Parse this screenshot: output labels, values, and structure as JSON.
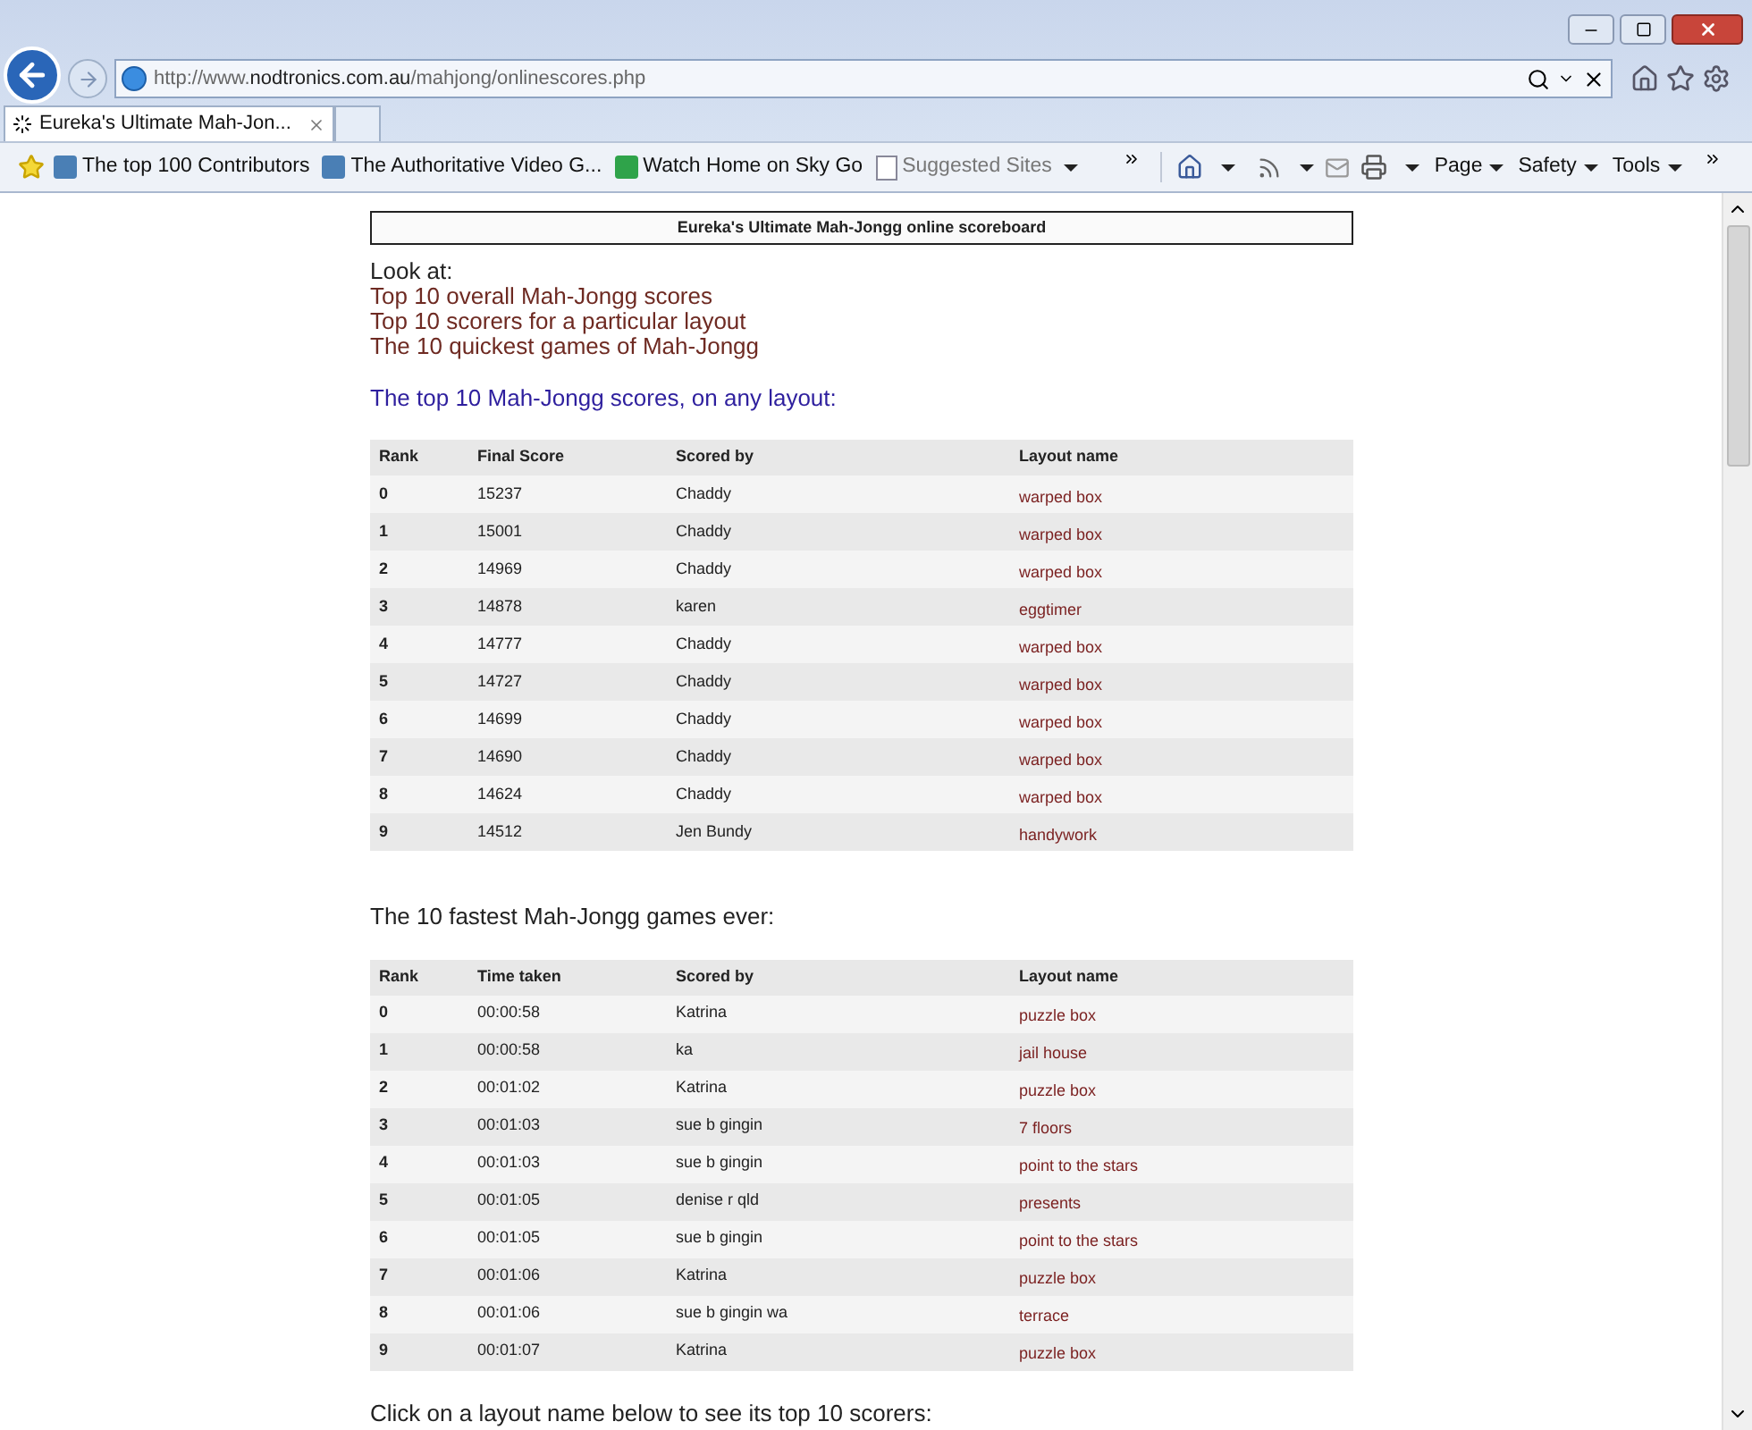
{
  "browser": {
    "url": {
      "prefix": "http://www.",
      "domain": "nodtronics.com.au",
      "path": "/mahjong/onlinescores.php"
    },
    "tab": {
      "title": "Eureka's Ultimate Mah-Jon...",
      "selected": true
    },
    "favorites": [
      "The top 100 Contributors",
      "The Authoritative Video G...",
      "Watch Home on Sky Go"
    ],
    "suggested": "Suggested Sites",
    "commands": [
      "Page",
      "Safety",
      "Tools"
    ]
  },
  "page": {
    "title": "Eureka's Ultimate Mah-Jongg online scoreboard",
    "look_at": "Look at:",
    "links": [
      "Top 10 overall Mah-Jongg scores",
      "Top 10 scorers for a particular layout",
      "The 10 quickest games of Mah-Jongg"
    ],
    "sections": [
      {
        "heading": "The top 10 Mah-Jongg scores, on any layout:",
        "kind": "accent",
        "columns": [
          "Rank",
          "Final Score",
          "Scored by",
          "Layout name"
        ],
        "rows": [
          [
            "0",
            "15237",
            "Chaddy",
            "warped box"
          ],
          [
            "1",
            "15001",
            "Chaddy",
            "warped box"
          ],
          [
            "2",
            "14969",
            "Chaddy",
            "warped box"
          ],
          [
            "3",
            "14878",
            "karen",
            "eggtimer"
          ],
          [
            "4",
            "14777",
            "Chaddy",
            "warped box"
          ],
          [
            "5",
            "14727",
            "Chaddy",
            "warped box"
          ],
          [
            "6",
            "14699",
            "Chaddy",
            "warped box"
          ],
          [
            "7",
            "14690",
            "Chaddy",
            "warped box"
          ],
          [
            "8",
            "14624",
            "Chaddy",
            "warped box"
          ],
          [
            "9",
            "14512",
            "Jen Bundy",
            "handywork"
          ]
        ]
      },
      {
        "heading": "The 10 fastest Mah-Jongg games ever:",
        "kind": "plain",
        "columns": [
          "Rank",
          "Time taken",
          "Scored by",
          "Layout name"
        ],
        "rows": [
          [
            "0",
            "00:00:58",
            "Katrina",
            "puzzle box"
          ],
          [
            "1",
            "00:00:58",
            "ka",
            "jail house"
          ],
          [
            "2",
            "00:01:02",
            "Katrina",
            "puzzle box"
          ],
          [
            "3",
            "00:01:03",
            "sue b gingin",
            "7 floors"
          ],
          [
            "4",
            "00:01:03",
            "sue b gingin",
            "point to the stars"
          ],
          [
            "5",
            "00:01:05",
            "denise r qld",
            "presents"
          ],
          [
            "6",
            "00:01:05",
            "sue b gingin",
            "point to the stars"
          ],
          [
            "7",
            "00:01:06",
            "Katrina",
            "puzzle box"
          ],
          [
            "8",
            "00:01:06",
            "sue b gingin wa",
            "terrace"
          ],
          [
            "9",
            "00:01:07",
            "Katrina",
            "puzzle box"
          ]
        ]
      }
    ],
    "footer": "Click on a layout name below to see its top 10 scorers:"
  }
}
